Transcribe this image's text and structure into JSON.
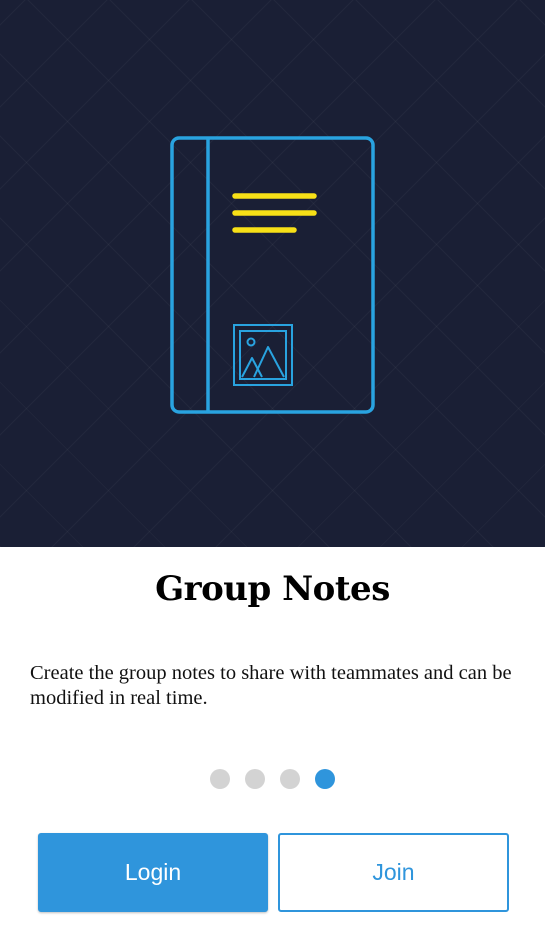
{
  "onboarding": {
    "illustration_icon": "notebook-icon",
    "title": "Group Notes",
    "description": "Create the group notes to share with teammates and can be modified in real time.",
    "pagination": {
      "total": 4,
      "active_index": 3
    }
  },
  "actions": {
    "login_label": "Login",
    "join_label": "Join"
  },
  "colors": {
    "hero_background": "#1a1f35",
    "illustration_stroke": "#29a3e0",
    "illustration_lines": "#f7e017",
    "accent": "#2f95dc",
    "dot_inactive": "#d3d3d3",
    "dot_active": "#2f95dc"
  }
}
